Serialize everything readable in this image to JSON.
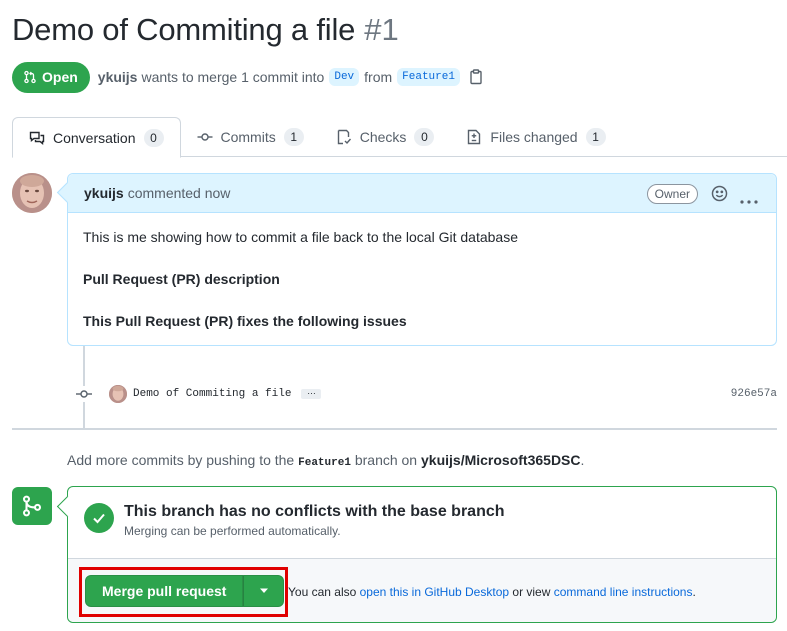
{
  "header": {
    "title": "Demo of Commiting a file",
    "number": "#1"
  },
  "meta": {
    "state": "Open",
    "author": "ykuijs",
    "text_merge": "wants to merge 1 commit into",
    "base_branch": "Dev",
    "text_from": "from",
    "head_branch": "Feature1"
  },
  "tabs": [
    {
      "label": "Conversation",
      "count": "0",
      "icon": "comment-discussion-icon"
    },
    {
      "label": "Commits",
      "count": "1",
      "icon": "git-commit-icon"
    },
    {
      "label": "Checks",
      "count": "0",
      "icon": "checklist-icon"
    },
    {
      "label": "Files changed",
      "count": "1",
      "icon": "file-diff-icon"
    }
  ],
  "comment": {
    "author": "ykuijs",
    "action": "commented now",
    "role_badge": "Owner",
    "body": [
      "This is me showing how to commit a file back to the local Git database",
      "Pull Request (PR) description",
      "This Pull Request (PR) fixes the following issues"
    ]
  },
  "commit": {
    "message": "Demo of Commiting a file",
    "ellipsis": "…",
    "sha": "926e57a"
  },
  "push_hint": {
    "prefix": "Add more commits by pushing to the",
    "branch": "Feature1",
    "middle": "branch on",
    "repo": "ykuijs/Microsoft365DSC",
    "suffix": "."
  },
  "merge": {
    "status_title": "This branch has no conflicts with the base branch",
    "status_sub": "Merging can be performed automatically.",
    "button_label": "Merge pull request",
    "alt_prefix": "You can also",
    "alt_link1": "open this in GitHub Desktop",
    "alt_middle": "or view",
    "alt_link2": "command line instructions",
    "alt_suffix": "."
  },
  "colors": {
    "accent_green": "#2da44e",
    "link_blue": "#0969da",
    "highlight_red": "#e00000"
  }
}
